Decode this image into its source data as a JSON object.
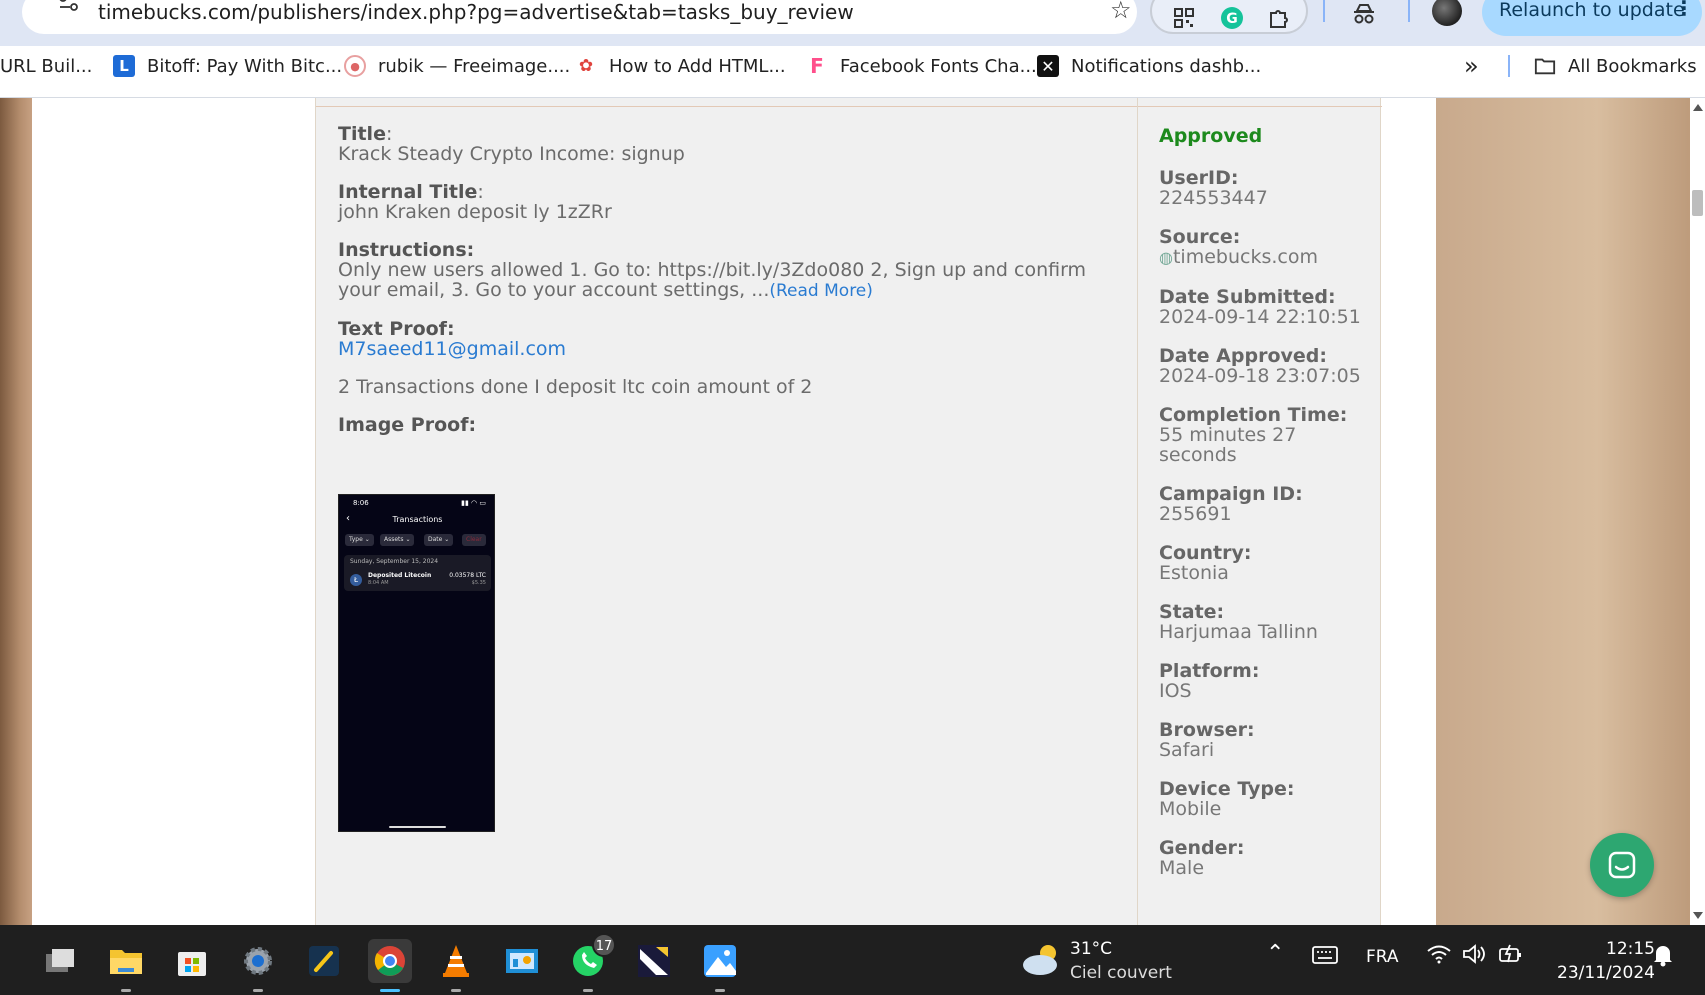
{
  "browser": {
    "url": "timebucks.com/publishers/index.php?pg=advertise&tab=tasks_buy_review",
    "relaunch_label": "Relaunch to update",
    "bookmarks": [
      {
        "label": "URL Buil...",
        "icon": "none"
      },
      {
        "label": "Bitoff: Pay With Bitc...",
        "icon": "bitoff-icon"
      },
      {
        "label": "rubik — Freeimage....",
        "icon": "freeimage-icon"
      },
      {
        "label": "How to Add HTML...",
        "icon": "html-icon"
      },
      {
        "label": "Facebook Fonts Cha...",
        "icon": "fonts-icon"
      },
      {
        "label": "Notifications dashb...",
        "icon": "x-icon"
      }
    ],
    "overflow_label": "»",
    "all_bookmarks_label": "All Bookmarks"
  },
  "task": {
    "title_label": "Title",
    "title_value": "Krack Steady Crypto Income: signup",
    "internal_title_label": "Internal Title",
    "internal_title_value": "john Kraken deposit ly 1zZRr",
    "instructions_label": "Instructions:",
    "instructions_value": "Only new users allowed 1. Go to: https://bit.ly/3Zdo080 2, Sign up and confirm your email, 3. Go to your account settings, ...",
    "read_more": "(Read More)",
    "text_proof_label": "Text Proof:",
    "text_proof_email": "M7saeed11@gmail.com",
    "text_proof_note": "2 Transactions done I deposit ltc coin amount of 2",
    "image_proof_label": "Image Proof:",
    "proof_image": {
      "time": "8:06",
      "screen_title": "Transactions",
      "filters": [
        "Type",
        "Assets",
        "Date",
        "Clear"
      ],
      "date": "Sunday, September 15, 2024",
      "tx_name": "Deposited Litecoin",
      "tx_time": "8:04 AM",
      "tx_amount": "0.03578 LTC",
      "tx_usd": "$5.35"
    }
  },
  "details": {
    "status": "Approved",
    "status_color": "#1d8a1d",
    "fields": [
      {
        "label": "UserID:",
        "value": "224553447"
      },
      {
        "label": "Source:",
        "value": "timebucks.com"
      },
      {
        "label": "Date Submitted:",
        "value": "2024-09-14 22:10:51"
      },
      {
        "label": "Date Approved:",
        "value": "2024-09-18 23:07:05"
      },
      {
        "label": "Completion Time:",
        "value": "55 minutes 27 seconds"
      },
      {
        "label": "Campaign ID:",
        "value": "255691"
      },
      {
        "label": "Country:",
        "value": "Estonia"
      },
      {
        "label": "State:",
        "value": "Harjumaa Tallinn"
      },
      {
        "label": "Platform:",
        "value": "IOS"
      },
      {
        "label": "Browser:",
        "value": "Safari"
      },
      {
        "label": "Device Type:",
        "value": "Mobile"
      },
      {
        "label": "Gender:",
        "value": "Male"
      }
    ]
  },
  "taskbar": {
    "weather_temp": "31°C",
    "weather_desc": "Ciel couvert",
    "language": "FRA",
    "time": "12:15",
    "date": "23/11/2024",
    "whatsapp_badge": "17"
  }
}
